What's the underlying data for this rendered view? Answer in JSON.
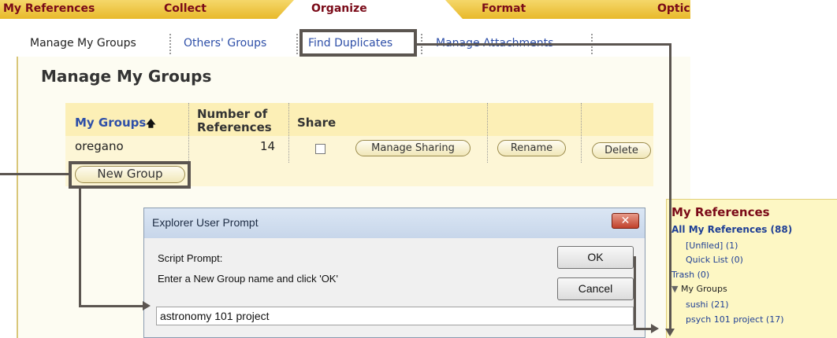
{
  "top_tabs": [
    "My References",
    "Collect",
    "Organize",
    "Format",
    "Optic"
  ],
  "sub_tabs": [
    "Manage My Groups",
    "Others' Groups",
    "Find Duplicates",
    "Manage Attachments"
  ],
  "page_title": "Manage My Groups",
  "table": {
    "col_groups": "My Groups",
    "sort_icon": "up-arrow-icon",
    "col_number_line1": "Number of",
    "col_number_line2": "References",
    "col_share": "Share",
    "row": {
      "name": "oregano",
      "count": "14",
      "share_checked": false,
      "manage_sharing": "Manage Sharing",
      "rename": "Rename",
      "delete": "Delete"
    },
    "new_group": "New Group"
  },
  "dialog": {
    "title": "Explorer User Prompt",
    "close": "✕",
    "label": "Script Prompt:",
    "instruction": "Enter a New Group name and click 'OK'",
    "ok": "OK",
    "cancel": "Cancel",
    "input_value": "astronomy 101 project"
  },
  "side_panel": {
    "title": "My References",
    "all": "All My References (88)",
    "unfiled": "[Unfiled] (1)",
    "quick_list": "Quick List (0)",
    "trash": "Trash (0)",
    "my_groups": "My Groups",
    "groups": [
      "sushi (21)",
      "psych 101 project (17)"
    ]
  }
}
